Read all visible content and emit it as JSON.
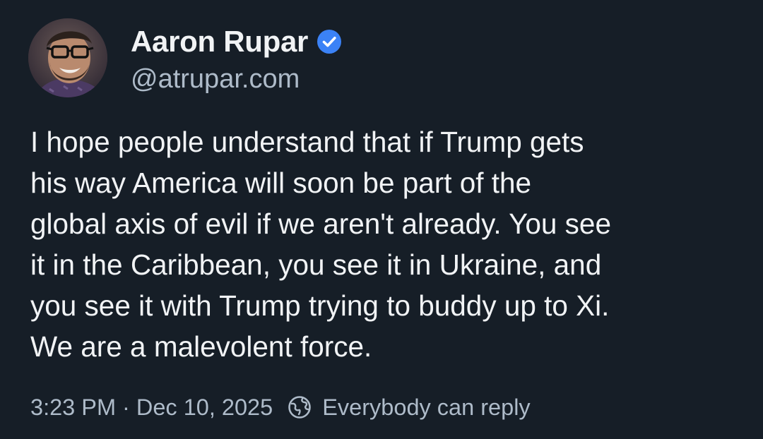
{
  "author": {
    "display_name": "Aaron Rupar",
    "handle": "@atrupar.com",
    "verified": true,
    "verified_color": "#3b82f6"
  },
  "post": {
    "text": "I hope people understand that if Trump gets\nhis way America will soon be part of the\nglobal axis of evil if we aren't already. You see\nit in the Caribbean, you see it in Ukraine, and\nyou see it with Trump trying to buddy up to Xi.\nWe are a malevolent force.",
    "time": "3:23 PM",
    "separator": "·",
    "date": "Dec 10, 2025",
    "reply_setting": "Everybody can reply"
  },
  "icons": {
    "verified": "verified-check-icon",
    "reply_setting": "globe-icon"
  },
  "colors": {
    "background": "#161e27",
    "text": "#f1f3f5",
    "secondary_text": "#aebbc9"
  }
}
